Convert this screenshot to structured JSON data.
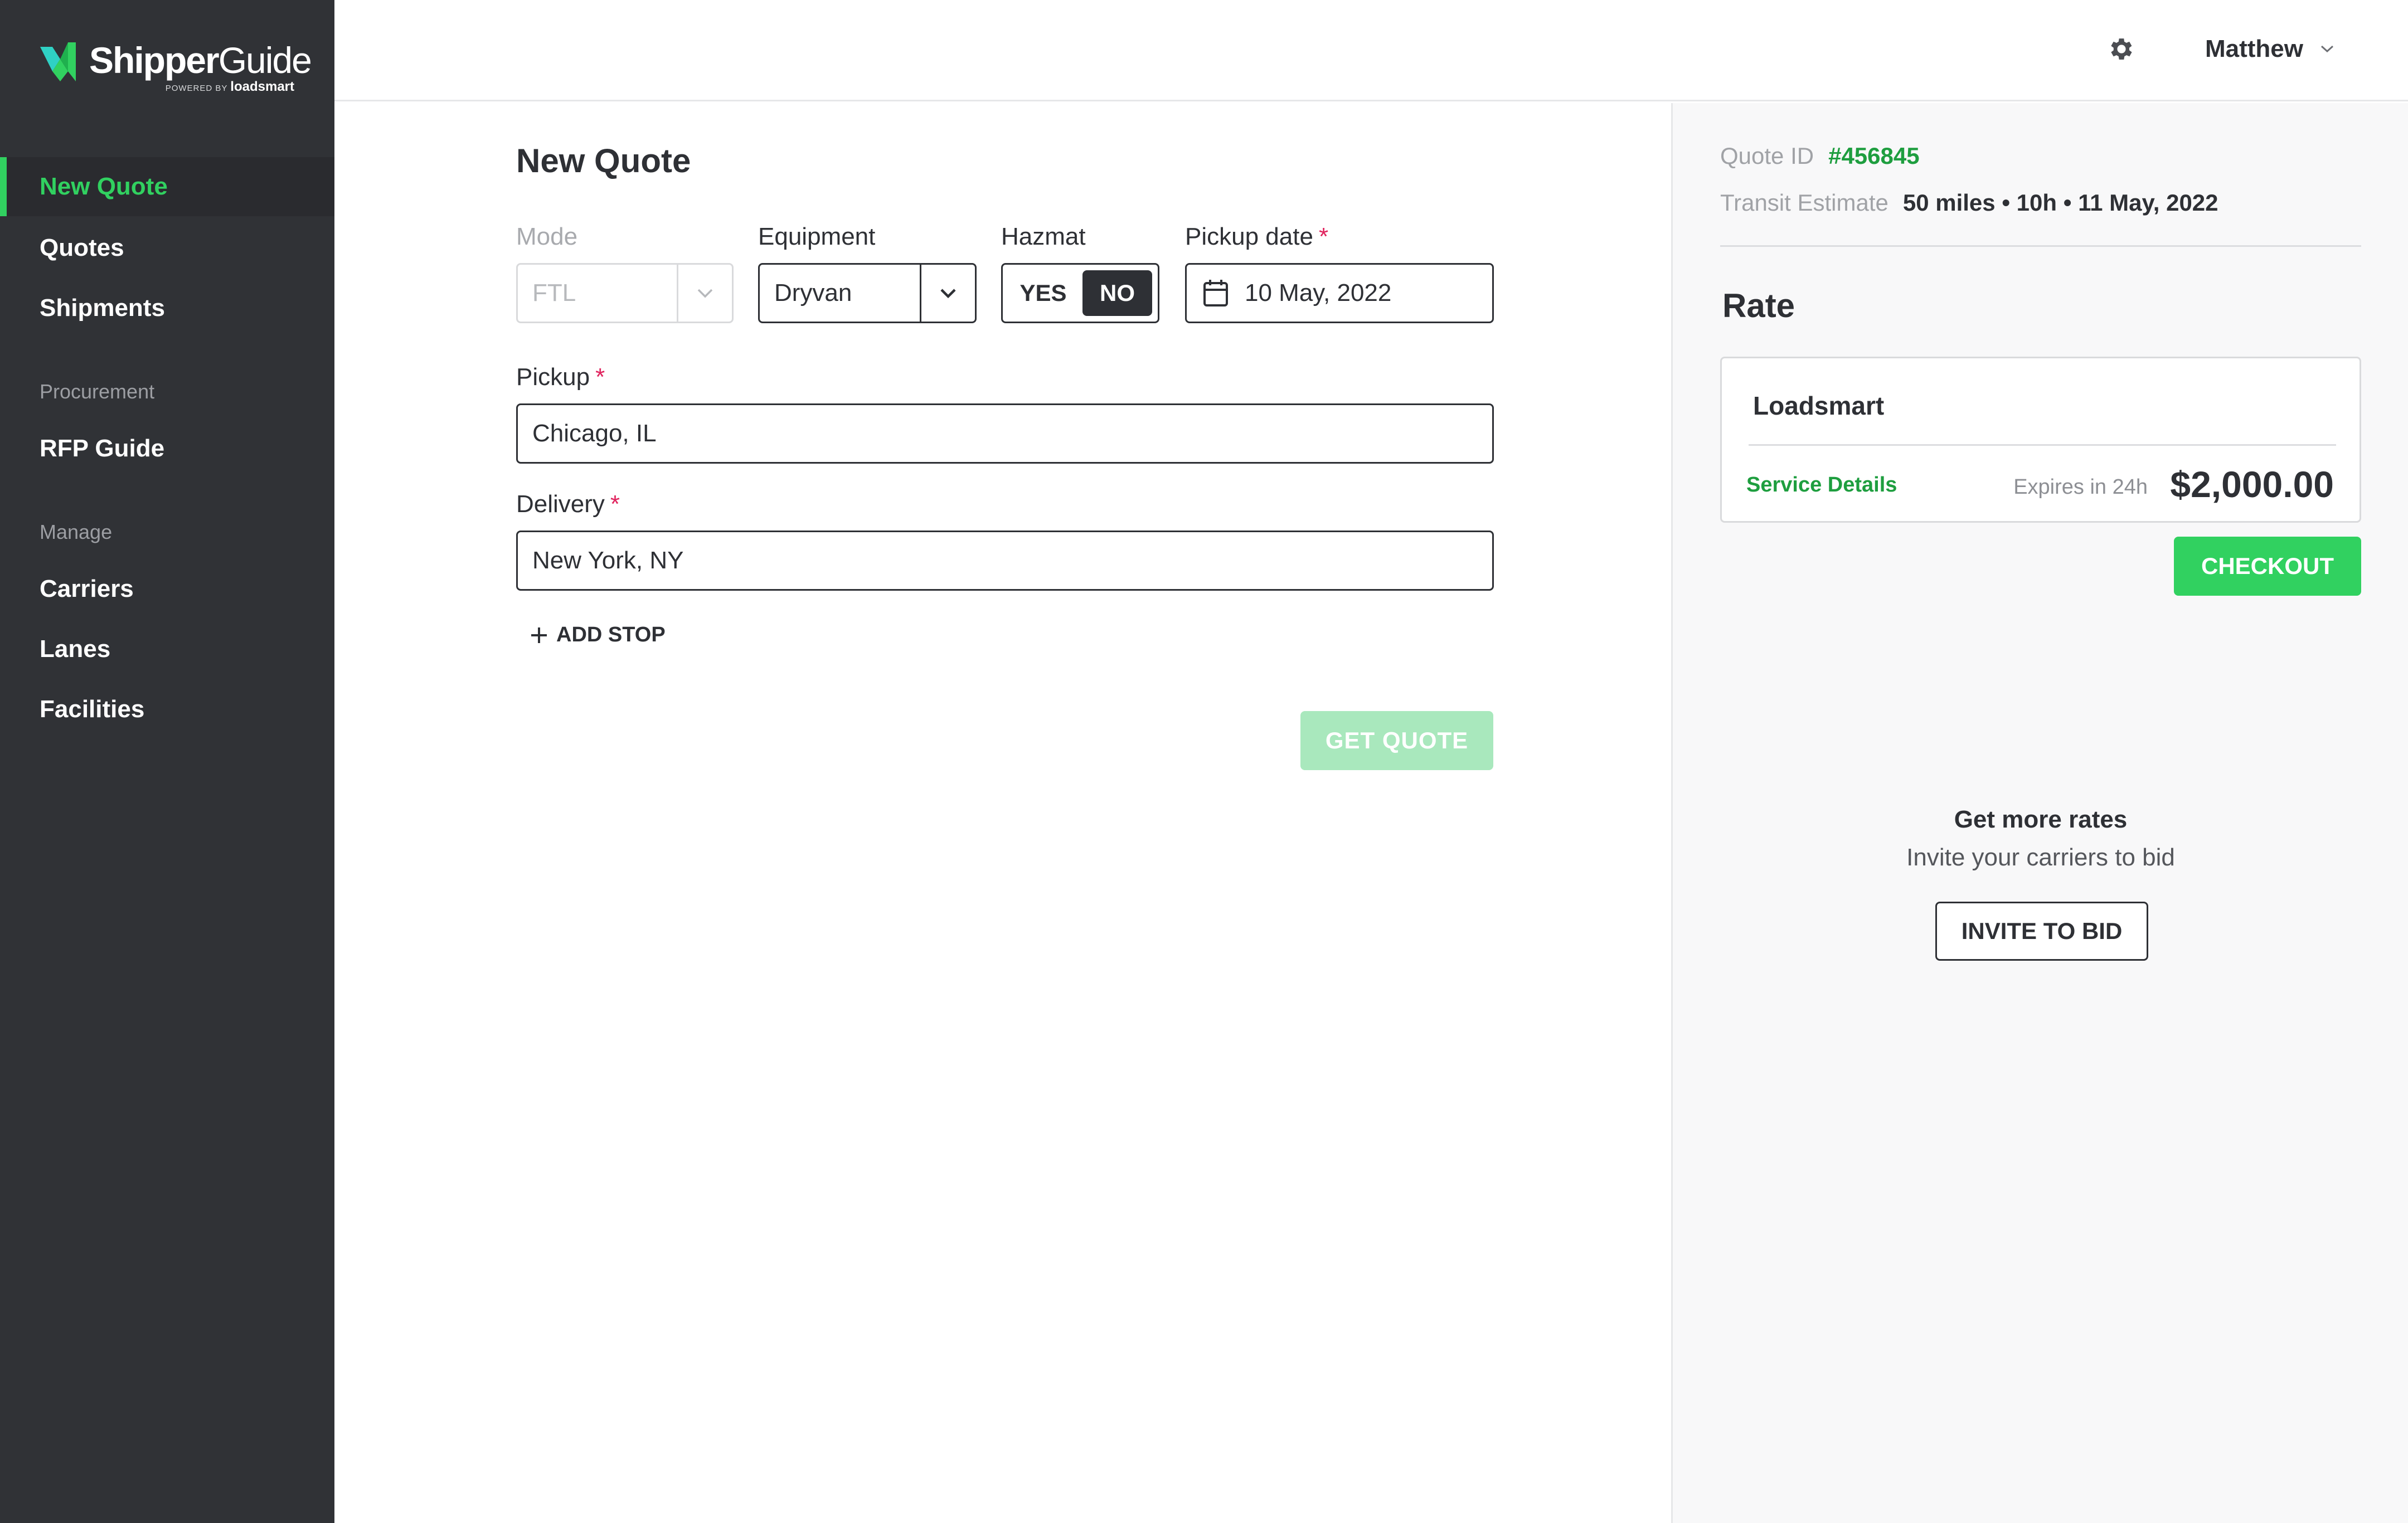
{
  "brand": {
    "name_bold": "Shipper",
    "name_light": "Guide",
    "powered_by": "POWERED BY",
    "powered_brand": "loadsmart",
    "accent": "#31d160",
    "accent_dark": "#1e9e3f"
  },
  "sidebar": {
    "items": [
      {
        "label": "New Quote",
        "active": true
      },
      {
        "label": "Quotes"
      },
      {
        "label": "Shipments"
      }
    ],
    "procurement_label": "Procurement",
    "procurement_items": [
      {
        "label": "RFP Guide"
      }
    ],
    "manage_label": "Manage",
    "manage_items": [
      {
        "label": "Carriers"
      },
      {
        "label": "Lanes"
      },
      {
        "label": "Facilities"
      }
    ]
  },
  "header": {
    "settings_icon": "gear-icon",
    "user_name": "Matthew",
    "user_menu_icon": "chevron-down-icon"
  },
  "form": {
    "title": "New Quote",
    "mode": {
      "label": "Mode",
      "value": "FTL",
      "disabled": true
    },
    "equipment": {
      "label": "Equipment",
      "value": "Dryvan"
    },
    "hazmat": {
      "label": "Hazmat",
      "yes": "YES",
      "no": "NO",
      "selected": "NO"
    },
    "pickup_date": {
      "label": "Pickup date",
      "required": "*",
      "value": "10 May, 2022",
      "icon": "calendar-icon"
    },
    "pickup": {
      "label": "Pickup",
      "required": "*",
      "value": "Chicago, IL"
    },
    "delivery": {
      "label": "Delivery",
      "required": "*",
      "value": "New York, NY"
    },
    "add_stop": "ADD STOP",
    "get_quote": "GET QUOTE"
  },
  "summary": {
    "quote_id_label": "Quote ID",
    "quote_id": "#456845",
    "transit_label": "Transit Estimate",
    "transit_value": "50 miles • 10h • 11 May, 2022",
    "rate_title": "Rate",
    "rate": {
      "carrier": "Loadsmart",
      "service_details": "Service Details",
      "expires": "Expires in 24h",
      "price": "$2,000.00"
    },
    "checkout": "CHECKOUT",
    "more_rates_title": "Get more rates",
    "more_rates_sub": "Invite your carriers to bid",
    "invite_button": "INVITE TO BID"
  }
}
